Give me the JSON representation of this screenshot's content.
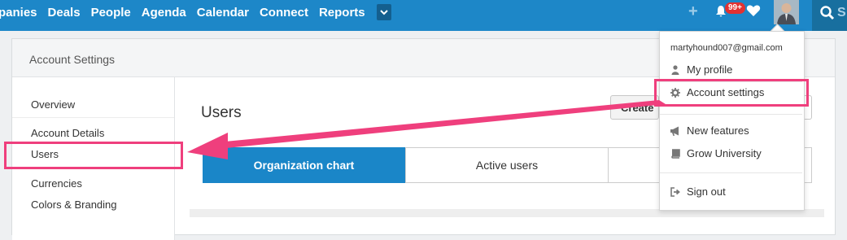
{
  "nav": {
    "items": [
      "panies",
      "Deals",
      "People",
      "Agenda",
      "Calendar",
      "Connect",
      "Reports"
    ],
    "more_icon": "chevron-down-icon"
  },
  "header_icons": {
    "add": "plus-icon",
    "notifications_badge": "99+",
    "favorites": "heart-icon",
    "search_partial": "S"
  },
  "card": {
    "title": "Account Settings"
  },
  "sidebar": {
    "items": [
      "Overview",
      "Account Details",
      "Users",
      "Currencies",
      "Colors & Branding"
    ]
  },
  "main": {
    "title": "Users",
    "create_button": "Create",
    "tabs": [
      "Organization chart",
      "Active users"
    ]
  },
  "dropdown": {
    "email": "martyhound007@gmail.com",
    "items": {
      "profile": "My profile",
      "account_settings": "Account settings",
      "new_features": "New features",
      "grow_university": "Grow University",
      "sign_out": "Sign out"
    }
  },
  "colors": {
    "brand_blue": "#1d87c8",
    "highlight_pink": "#ef3f7d",
    "badge_red": "#e23131"
  }
}
